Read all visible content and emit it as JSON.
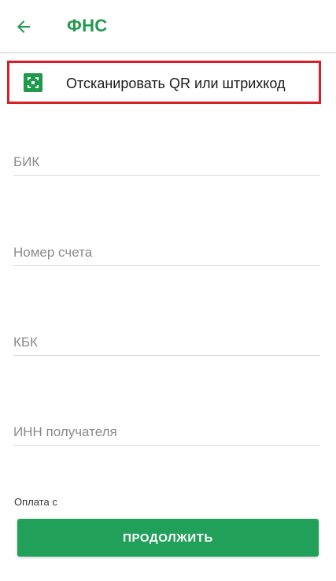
{
  "toolbar": {
    "title": "ФНС",
    "back_icon": "arrow-left-icon"
  },
  "scan": {
    "label": "Отсканировать QR или штрихкод",
    "icon": "qr-code-icon"
  },
  "form": {
    "bik_placeholder": "БИК",
    "account_placeholder": "Номер счета",
    "kbk_placeholder": "КБК",
    "inn_placeholder": "ИНН получателя",
    "pay_from_label": "Оплата с"
  },
  "actions": {
    "continue_label": "ПРОДОЛЖИТЬ"
  },
  "colors": {
    "accent": "#1f9a4c",
    "button": "#21a05a",
    "highlight_border": "#d61f26"
  }
}
